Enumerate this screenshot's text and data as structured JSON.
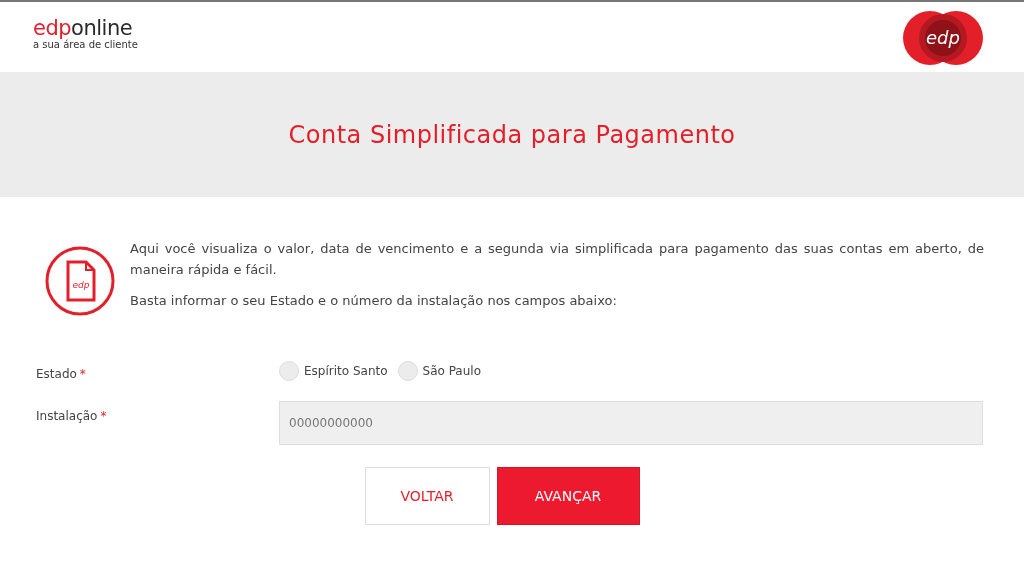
{
  "header": {
    "logo_brand": "edp",
    "logo_product": "online",
    "tagline": "a sua área de cliente",
    "badge_text": "edp"
  },
  "title": "Conta Simplificada para Pagamento",
  "intro": {
    "icon_text": "edp",
    "paragraphs": [
      "Aqui você visualiza o valor, data de vencimento e a segunda via simplificada para pagamento das suas contas em aberto, de maneira rápida e fácil.",
      "Basta informar o seu Estado e o número da instalação nos campos abaixo:"
    ]
  },
  "form": {
    "estado": {
      "label": "Estado",
      "required_mark": "*",
      "options": [
        {
          "label": "Espírito Santo",
          "selected": false
        },
        {
          "label": "São Paulo",
          "selected": false
        }
      ]
    },
    "instalacao": {
      "label": "Instalação",
      "required_mark": "*",
      "placeholder": "00000000000"
    }
  },
  "buttons": [
    {
      "label": "VOLTAR",
      "kind": "secondary"
    },
    {
      "label": "AVANÇAR",
      "kind": "primary"
    }
  ]
}
